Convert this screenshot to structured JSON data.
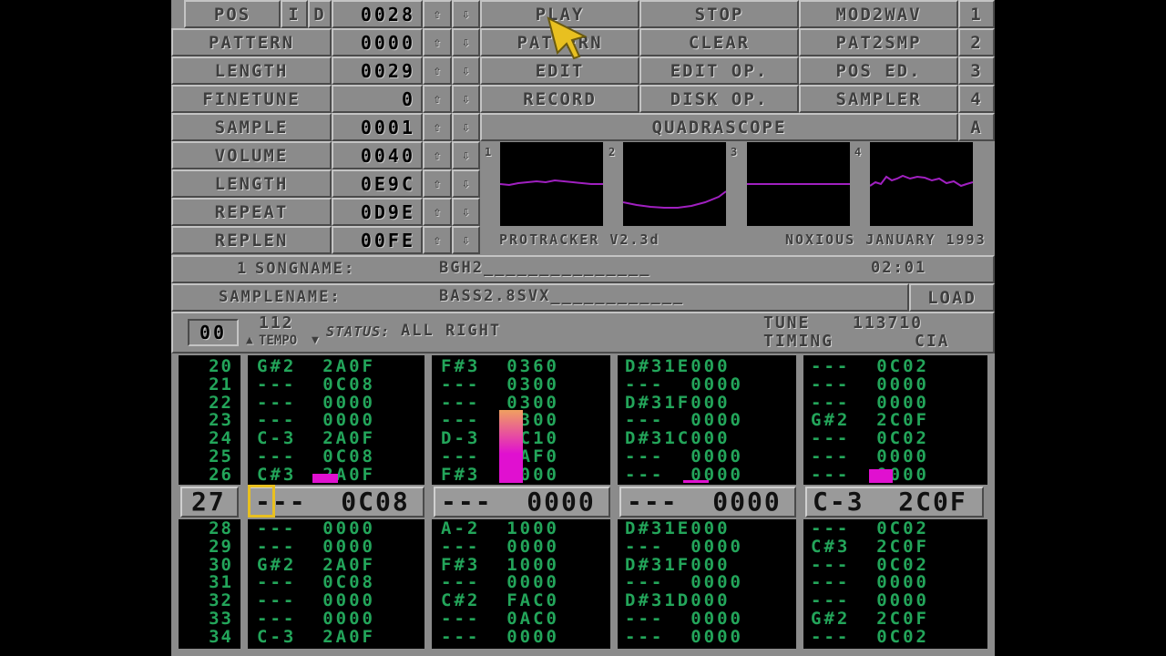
{
  "info": [
    {
      "label": "POS",
      "value": "0028",
      "extra": "I D"
    },
    {
      "label": "PATTERN",
      "value": "0000"
    },
    {
      "label": "LENGTH",
      "value": "0029"
    },
    {
      "label": "FINETUNE",
      "value": "0"
    },
    {
      "label": "SAMPLE",
      "value": "0001"
    },
    {
      "label": "VOLUME",
      "value": "0040"
    },
    {
      "label": "LENGTH",
      "value": "0E9C"
    },
    {
      "label": "REPEAT",
      "value": "0D9E"
    },
    {
      "label": "REPLEN",
      "value": "00FE"
    }
  ],
  "arrows": {
    "up": "⇧",
    "down": "⇩"
  },
  "buttons": [
    [
      "PLAY",
      "STOP",
      "MOD2WAV",
      "1"
    ],
    [
      "PATTERN",
      "CLEAR",
      "PAT2SMP",
      "2"
    ],
    [
      "EDIT",
      "EDIT OP.",
      "POS ED.",
      "3"
    ],
    [
      "RECORD",
      "DISK OP.",
      "SAMPLER",
      "4"
    ]
  ],
  "quadrascope": {
    "label": "QUADRASCOPE",
    "toggle": "A",
    "channels": [
      "1",
      "2",
      "3",
      "4"
    ],
    "wave_color": "#a020c0"
  },
  "credits": {
    "left": "PROTRACKER V2.3d",
    "right": "NOXIOUS JANUARY 1993"
  },
  "song": {
    "prefix": "1",
    "label": "SONGNAME:",
    "name": "BGH2_______________",
    "time": "02:01"
  },
  "sample": {
    "label": "SAMPLENAME:",
    "name": "BASS2.8SVX____________",
    "load": "LOAD"
  },
  "status": {
    "octave": "00",
    "tempo": "112",
    "tempo_label": "TEMPO",
    "status_label": "STATUS:",
    "status": "ALL RIGHT",
    "tune_label": "TUNE",
    "tune": "113710",
    "timing_label": "TIMING",
    "timing": "CIA"
  },
  "pattern": {
    "rows_before": [
      "20",
      "21",
      "22",
      "23",
      "24",
      "25",
      "26"
    ],
    "current": "27",
    "rows_after": [
      "28",
      "29",
      "30",
      "31",
      "32",
      "33",
      "34"
    ],
    "channels": [
      {
        "before": [
          "G#2  2A0F",
          "---  0C08",
          "---  0000",
          "---  0000",
          "C-3  2A0F",
          "---  0C08",
          "C#3  2A0F"
        ],
        "current": "---  0C08",
        "after": [
          "---  0000",
          "---  0000",
          "G#2  2A0F",
          "---  0C08",
          "---  0000",
          "---  0000",
          "C-3  2A0F"
        ]
      },
      {
        "before": [
          "F#3  0360",
          "---  0300",
          "---  0300",
          "---  0300",
          "D-3  1C10",
          "---  0AF0",
          "F#3  1000"
        ],
        "current": "---  0000",
        "after": [
          "A-2  1000",
          "---  0000",
          "F#3  1000",
          "---  0000",
          "C#2  FAC0",
          "---  0AC0",
          "---  0000"
        ]
      },
      {
        "before": [
          "D#31E000",
          "---  0000",
          "D#31F000",
          "---  0000",
          "D#31C000",
          "---  0000",
          "---  0000"
        ],
        "current": "---  0000",
        "after": [
          "D#31E000",
          "---  0000",
          "D#31F000",
          "---  0000",
          "D#31D000",
          "---  0000",
          "---  0000"
        ]
      },
      {
        "before": [
          "---  0C02",
          "---  0000",
          "---  0000",
          "G#2  2C0F",
          "---  0C02",
          "---  0000",
          "---  0000"
        ],
        "current": "C-3  2C0F",
        "after": [
          "---  0C02",
          "C#3  2C0F",
          "---  0C02",
          "---  0000",
          "---  0000",
          "G#2  2C0F",
          "---  0C02"
        ]
      }
    ]
  },
  "vu_levels": [
    0.1,
    0.8,
    0.03,
    0.15
  ],
  "colors": {
    "note_green": "#23a55a",
    "vu_magenta": "#e010d0",
    "vu_orange": "#f0a060",
    "cursor": "#e8c020",
    "pointer": "#e8c020"
  }
}
